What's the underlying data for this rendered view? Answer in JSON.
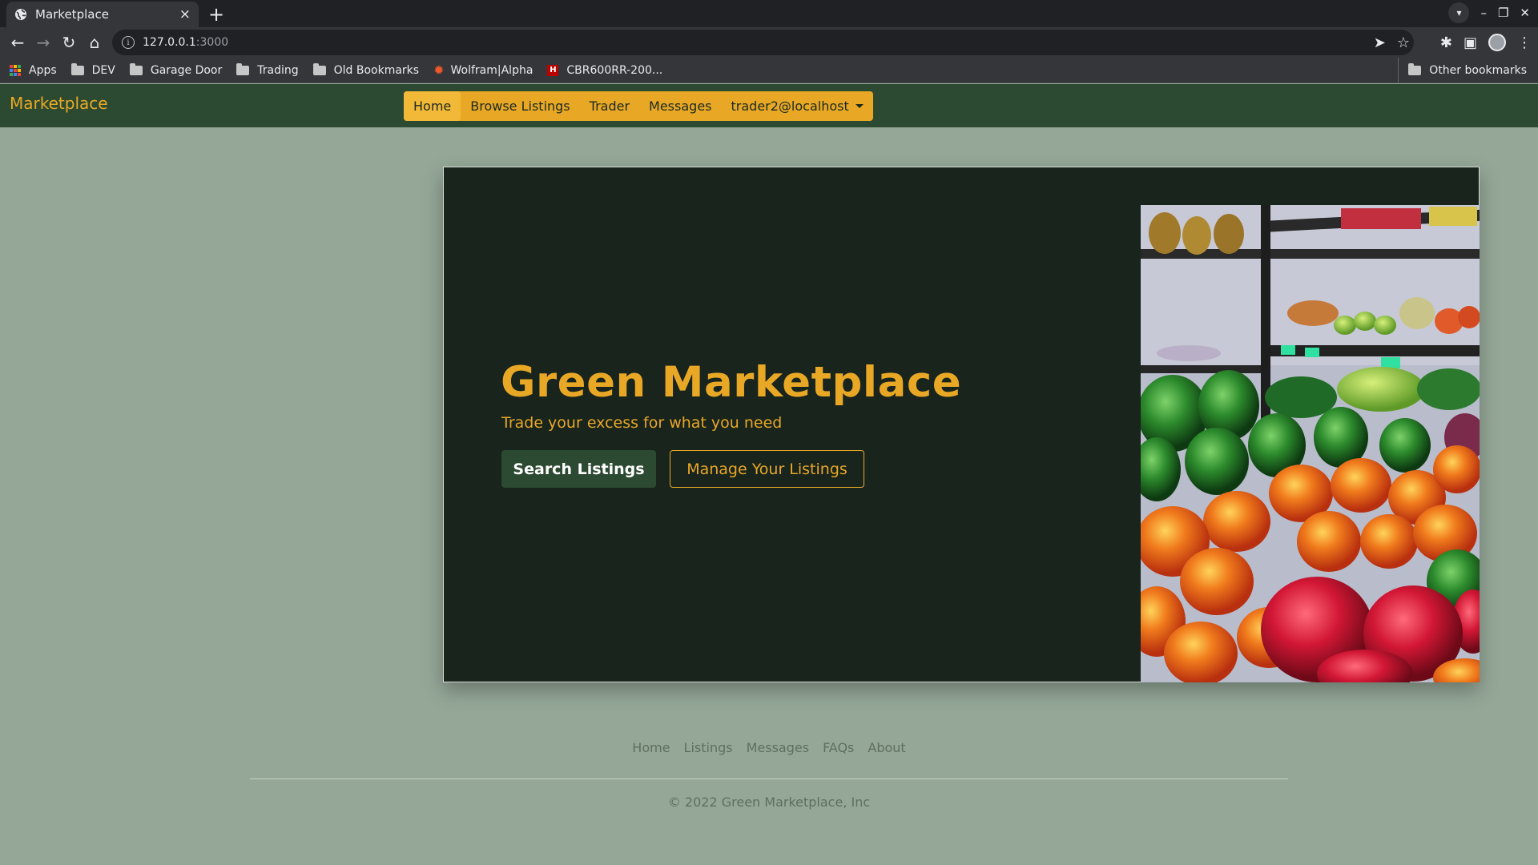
{
  "browser": {
    "tab_title": "Marketplace",
    "tab_close": "×",
    "new_tab": "+",
    "url_host": "127.0.0.1",
    "url_rest": ":3000",
    "bookmarks": [
      {
        "label": "Apps",
        "icon": "apps-grid-icon"
      },
      {
        "label": "DEV",
        "icon": "folder-icon"
      },
      {
        "label": "Garage Door",
        "icon": "folder-icon"
      },
      {
        "label": "Trading",
        "icon": "folder-icon"
      },
      {
        "label": "Old Bookmarks",
        "icon": "folder-icon"
      },
      {
        "label": "Wolfram|Alpha",
        "icon": "wolfram-icon"
      },
      {
        "label": "CBR600RR-200...",
        "icon": "cbr-icon"
      }
    ],
    "other_bookmarks": "Other bookmarks"
  },
  "site": {
    "brand": "Marketplace",
    "nav": {
      "home": "Home",
      "browse": "Browse Listings",
      "trader": "Trader",
      "messages": "Messages",
      "user": "trader2@localhost"
    },
    "hero": {
      "title": "Green Marketplace",
      "subtitle": "Trade your excess for what you need",
      "primary_button": "Search Listings",
      "secondary_button": "Manage Your Listings"
    },
    "footer": {
      "links": [
        "Home",
        "Listings",
        "Messages",
        "FAQs",
        "About"
      ],
      "copyright": "© 2022 Green Marketplace, Inc"
    }
  },
  "colors": {
    "accent": "#e8a825",
    "nav_bg": "#2c4a32",
    "hero_bg": "#18241c",
    "page_bg": "#95a898"
  }
}
